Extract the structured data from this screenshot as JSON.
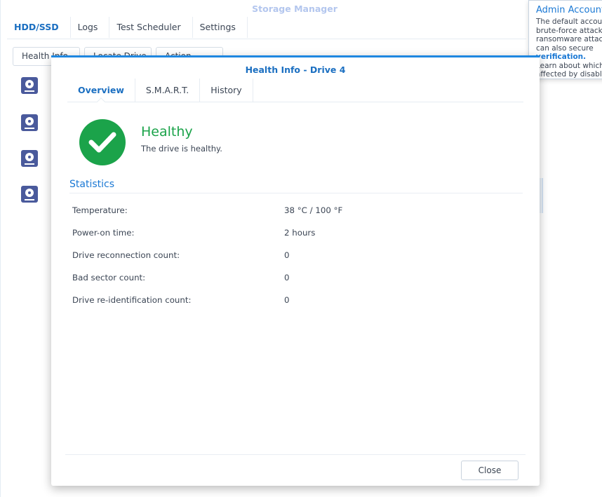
{
  "background_window": {
    "title": "Storage Manager",
    "tabs": [
      {
        "label": "HDD/SSD",
        "active": true
      },
      {
        "label": "Logs",
        "active": false
      },
      {
        "label": "Test Scheduler",
        "active": false
      },
      {
        "label": "Settings",
        "active": false
      }
    ],
    "toolbar": [
      "Health Info",
      "Locate Drive",
      "Action"
    ]
  },
  "notification": {
    "title": "Admin Account",
    "lines": [
      "The default account",
      "brute-force attacks",
      "ransomware attacks",
      "can also secure"
    ],
    "link": "verification.",
    "tail_lines": [
      "Learn about which",
      "affected by disabling"
    ]
  },
  "dialog": {
    "title": "Health Info - Drive 4",
    "tabs": [
      {
        "label": "Overview",
        "active": true
      },
      {
        "label": "S.M.A.R.T.",
        "active": false
      },
      {
        "label": "History",
        "active": false
      }
    ],
    "status": "Healthy",
    "status_description": "The drive is healthy.",
    "section_title": "Statistics",
    "stats": [
      {
        "label": "Temperature:",
        "value": "38 °C / 100 °F"
      },
      {
        "label": "Power-on time:",
        "value": "2 hours"
      },
      {
        "label": "Drive reconnection count:",
        "value": "0"
      },
      {
        "label": "Bad sector count:",
        "value": "0"
      },
      {
        "label": "Drive re-identification count:",
        "value": "0"
      }
    ],
    "close_label": "Close"
  },
  "colors": {
    "accent": "#1b6fc1",
    "healthy": "#1ba34a",
    "drive_icon": "#4a5a9c"
  }
}
